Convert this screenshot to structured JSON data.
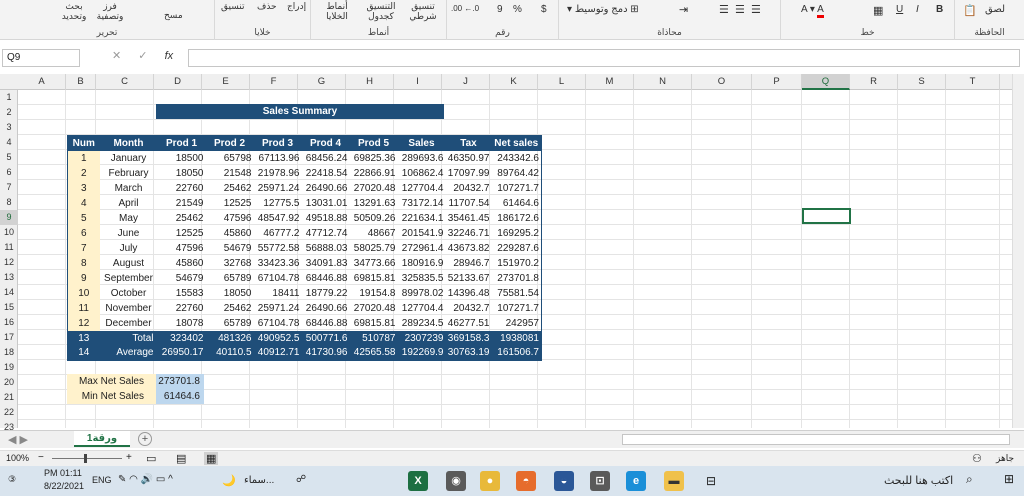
{
  "ribbon": {
    "groups": {
      "clipboard": "الحافظة",
      "font": "خط",
      "alignment": "محاذاة",
      "number": "رقم",
      "styles": "أنماط",
      "cells": "خلايا",
      "editing": "تحرير"
    },
    "items": {
      "paste": "لصق",
      "merge_center": "دمج وتوسيط",
      "currency": "$",
      "percent": "%",
      "comma": "9",
      "conditional_format": "تنسيق شرطي",
      "format_table": "التنسيق كجدول",
      "cell_styles": "أنماط الخلايا",
      "insert": "إدراج",
      "delete": "حذف",
      "format": "تنسيق",
      "clear": "مسح",
      "sort_filter": "فرز وتصفية",
      "find_select": "بحث وتحديد",
      "bold": "B",
      "italic": "I",
      "underline": "U"
    }
  },
  "formula_bar": {
    "name_box": "Q9",
    "fx": "fx",
    "formula": ""
  },
  "columns": [
    "A",
    "B",
    "C",
    "D",
    "E",
    "F",
    "G",
    "H",
    "I",
    "J",
    "K",
    "L",
    "M",
    "N",
    "O",
    "P",
    "Q",
    "R",
    "S",
    "T"
  ],
  "selected_column": "Q",
  "selected_row": "9",
  "rows": [
    "1",
    "2",
    "3",
    "4",
    "5",
    "6",
    "7",
    "8",
    "9",
    "10",
    "11",
    "12",
    "13",
    "14",
    "15",
    "16",
    "17",
    "18",
    "19",
    "20",
    "21",
    "22",
    "23"
  ],
  "sheet": {
    "title": "Sales Summary",
    "headers": [
      "Num",
      "Month",
      "Prod 1",
      "Prod 2",
      "Prod 3",
      "Prod 4",
      "Prod 5",
      "Sales",
      "Tax",
      "Net sales"
    ],
    "rows": [
      [
        "1",
        "January",
        "18500",
        "65798",
        "67113.96",
        "68456.24",
        "69825.36",
        "289693.6",
        "46350.97",
        "243342.6"
      ],
      [
        "2",
        "February",
        "18050",
        "21548",
        "21978.96",
        "22418.54",
        "22866.91",
        "106862.4",
        "17097.99",
        "89764.42"
      ],
      [
        "3",
        "March",
        "22760",
        "25462",
        "25971.24",
        "26490.66",
        "27020.48",
        "127704.4",
        "20432.7",
        "107271.7"
      ],
      [
        "4",
        "April",
        "21549",
        "12525",
        "12775.5",
        "13031.01",
        "13291.63",
        "73172.14",
        "11707.54",
        "61464.6"
      ],
      [
        "5",
        "May",
        "25462",
        "47596",
        "48547.92",
        "49518.88",
        "50509.26",
        "221634.1",
        "35461.45",
        "186172.6"
      ],
      [
        "6",
        "June",
        "12525",
        "45860",
        "46777.2",
        "47712.74",
        "48667",
        "201541.9",
        "32246.71",
        "169295.2"
      ],
      [
        "7",
        "July",
        "47596",
        "54679",
        "55772.58",
        "56888.03",
        "58025.79",
        "272961.4",
        "43673.82",
        "229287.6"
      ],
      [
        "8",
        "August",
        "45860",
        "32768",
        "33423.36",
        "34091.83",
        "34773.66",
        "180916.9",
        "28946.7",
        "151970.2"
      ],
      [
        "9",
        "September",
        "54679",
        "65789",
        "67104.78",
        "68446.88",
        "69815.81",
        "325835.5",
        "52133.67",
        "273701.8"
      ],
      [
        "10",
        "October",
        "15583",
        "18050",
        "18411",
        "18779.22",
        "19154.8",
        "89978.02",
        "14396.48",
        "75581.54"
      ],
      [
        "11",
        "November",
        "22760",
        "25462",
        "25971.24",
        "26490.66",
        "27020.48",
        "127704.4",
        "20432.7",
        "107271.7"
      ],
      [
        "12",
        "December",
        "18078",
        "65789",
        "67104.78",
        "68446.88",
        "69815.81",
        "289234.5",
        "46277.51",
        "242957"
      ]
    ],
    "summary": [
      [
        "13",
        "Total",
        "323402",
        "481326",
        "490952.5",
        "500771.6",
        "510787",
        "2307239",
        "369158.3",
        "1938081"
      ],
      [
        "14",
        "Average",
        "26950.17",
        "40110.5",
        "40912.71",
        "41730.96",
        "42565.58",
        "192269.9",
        "30763.19",
        "161506.7"
      ]
    ],
    "max_label": "Max Net Sales",
    "max_value": "273701.8",
    "min_label": "Min Net Sales",
    "min_value": "61464.6"
  },
  "tabs": {
    "sheet_name": "ورقة1"
  },
  "status": {
    "ready": "جاهز",
    "zoom": "100%"
  },
  "taskbar": {
    "search_placeholder": "اكتب هنا للبحث",
    "time": "PM 01:11",
    "date": "8/22/2021",
    "lang": "ENG",
    "weather": "سماء..."
  }
}
